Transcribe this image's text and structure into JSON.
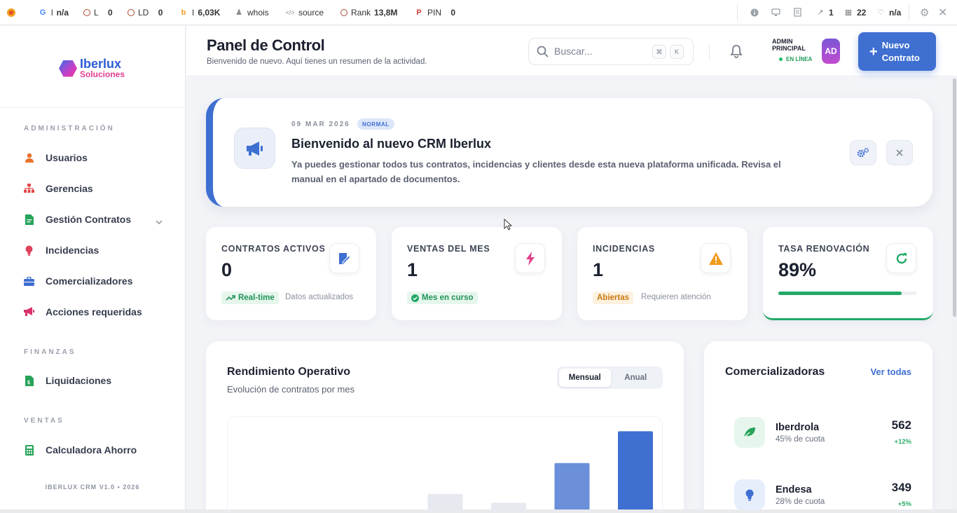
{
  "extension_bar": {
    "items": [
      {
        "label": "l",
        "value": "n/a"
      },
      {
        "label": "L",
        "value": "0"
      },
      {
        "label": "LD",
        "value": "0"
      },
      {
        "label": "I",
        "value": "6,03K"
      },
      {
        "label": "whois",
        "value": ""
      },
      {
        "label": "source",
        "value": ""
      },
      {
        "label": "Rank",
        "value": "13,8M"
      },
      {
        "label": "PIN",
        "value": "0"
      }
    ],
    "right": {
      "links": "1",
      "pages": "22",
      "heart": "n/a"
    }
  },
  "sidebar": {
    "brand": {
      "name": "Iberlux",
      "sub": "Soluciones"
    },
    "sections": [
      {
        "title": "ADMINISTRACIÓN",
        "items": [
          {
            "label": "Usuarios",
            "icon": "user-icon",
            "color": "#e8732c"
          },
          {
            "label": "Gerencias",
            "icon": "sitemap-icon",
            "color": "#e04848"
          },
          {
            "label": "Gestión Contratos",
            "icon": "file-contract-icon",
            "color": "#27a35a"
          },
          {
            "label": "Incidencias",
            "icon": "lightbulb-icon",
            "color": "#e0405a"
          },
          {
            "label": "Comercializadores",
            "icon": "briefcase-icon",
            "color": "#3e6fd1"
          },
          {
            "label": "Acciones requeridas",
            "icon": "megaphone-icon",
            "color": "#d8336a"
          }
        ]
      },
      {
        "title": "FINANZAS",
        "items": [
          {
            "label": "Liquidaciones",
            "icon": "file-invoice-icon",
            "color": "#27a35a"
          }
        ]
      },
      {
        "title": "VENTAS",
        "items": [
          {
            "label": "Calculadora Ahorro",
            "icon": "calculator-icon",
            "color": "#27a35a"
          }
        ]
      }
    ],
    "footer": "IBERLUX CRM V1.0 • 2026"
  },
  "header": {
    "title": "Panel de Control",
    "subtitle": "Bienvenido de nuevo. Aquí tienes un resumen de la actividad.",
    "search_placeholder": "Buscar...",
    "shortcut_keys": [
      "⌘",
      "K"
    ],
    "user": {
      "name": "ADMIN PRINCIPAL",
      "status": "EN LÍNEA",
      "initials": "AD"
    },
    "new_button": "Nuevo Contrato"
  },
  "welcome": {
    "date": "09 MAR 2026",
    "badge": "NORMAL",
    "title": "Bienvenido al nuevo CRM Iberlux",
    "message": "Ya puedes gestionar todos tus contratos, incidencias y clientes desde esta nueva plataforma unificada. Revisa el manual en el apartado de documentos."
  },
  "stats": [
    {
      "label": "CONTRATOS ACTIVOS",
      "value": "0",
      "pill": "Real-time",
      "note": "Datos actualizados",
      "accent": "#3e6fd1"
    },
    {
      "label": "VENTAS DEL MES",
      "value": "1",
      "pill": "Mes en curso",
      "note": "",
      "accent": "#e0408c"
    },
    {
      "label": "INCIDENCIAS",
      "value": "1",
      "pill": "Abiertas",
      "note": "Requieren atención",
      "accent": "#f09a1c"
    },
    {
      "label": "TASA RENOVACIÓN",
      "value": "89%",
      "progress": 0.89,
      "accent": "#22a866"
    }
  ],
  "performance": {
    "title": "Rendimiento Operativo",
    "subtitle": "Evolución de contratos por mes",
    "toggle": [
      "Mensual",
      "Anual"
    ],
    "active_toggle": "Mensual"
  },
  "chart_data": {
    "type": "bar",
    "categories": [
      "",
      "",
      "",
      "",
      "",
      "",
      ""
    ],
    "values": [
      0,
      7,
      0,
      38,
      27,
      77,
      117
    ],
    "title": "",
    "xlabel": "",
    "ylabel": "",
    "ylim": [
      0,
      135
    ],
    "grid": false,
    "colors": [
      "#e6e9ef",
      "#e6e9ef",
      "#e6e9ef",
      "#e6e9ef",
      "#e6e9ef",
      "#6b8fd9",
      "#3e6fd1"
    ]
  },
  "comercializadoras": {
    "title": "Comercializadoras",
    "link": "Ver todas",
    "items": [
      {
        "name": "Iberdrola",
        "share": "45% de cuota",
        "count": "562",
        "growth": "+12%",
        "icon": "leaf-icon",
        "bg": "#e6f6ec",
        "color": "#27a35a"
      },
      {
        "name": "Endesa",
        "share": "28% de cuota",
        "count": "349",
        "growth": "+5%",
        "icon": "lightbulb-icon",
        "bg": "#e6eefc",
        "color": "#3e6fd1"
      }
    ]
  }
}
